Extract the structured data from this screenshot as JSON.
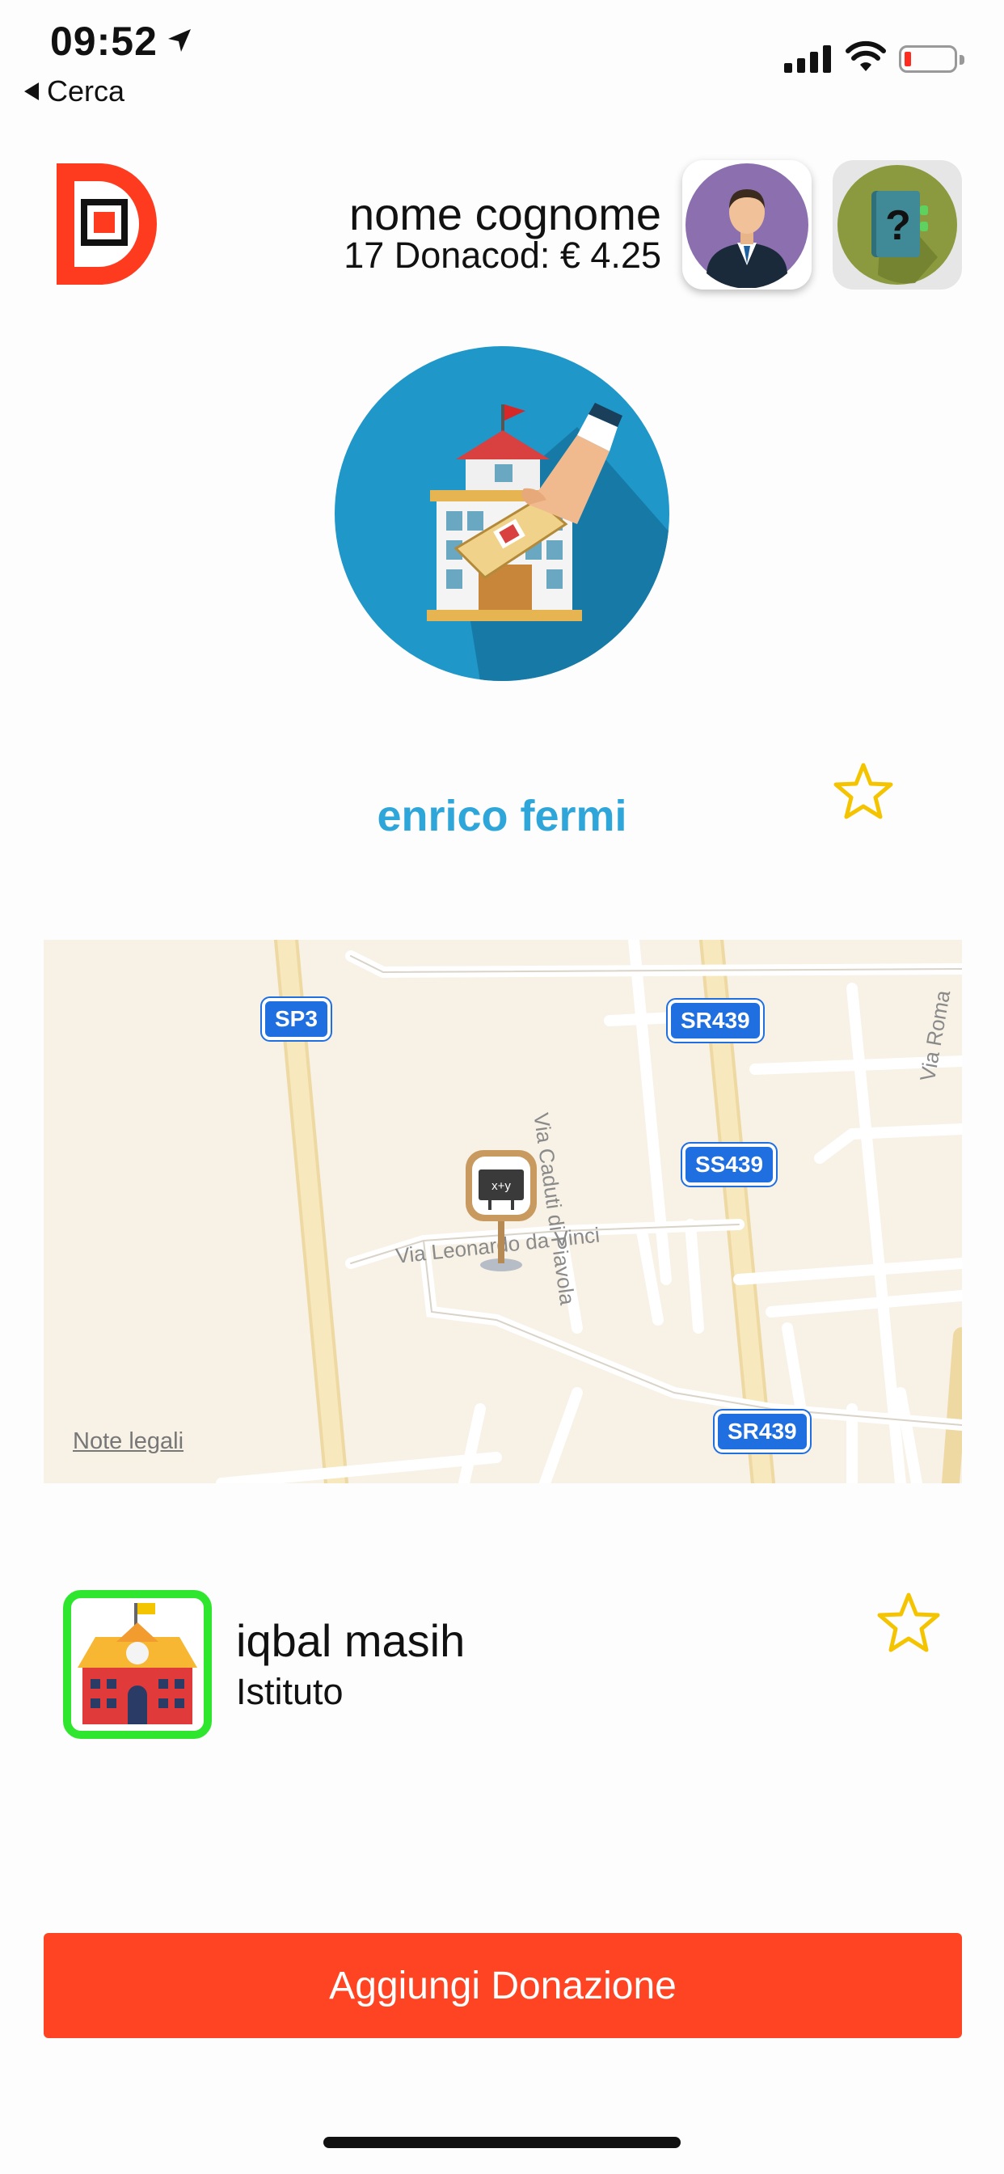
{
  "status_bar": {
    "time": "09:52",
    "back_label": "Cerca"
  },
  "header": {
    "user_name": "nome cognome",
    "user_balance": "17 Donacod: € 4.25",
    "avatar_icon": "person-avatar-icon",
    "help_icon": "help-book-icon"
  },
  "institution": {
    "name": "enrico fermi",
    "hero_icon": "school-donation-icon",
    "favorite_icon": "star-outline-icon"
  },
  "map": {
    "legal_link": "Note legali",
    "roads": {
      "sp3": "SP3",
      "sr439_top": "SR439",
      "ss439": "SS439",
      "sr439_bottom": "SR439",
      "via_caduti": "Via Caduti di Piavola",
      "via_roma": "Via Roma",
      "via_leonardo": "Via Leonardo da Vinci"
    }
  },
  "list": {
    "items": [
      {
        "name": "iqbal masih",
        "type": "Istituto",
        "icon": "school-building-icon"
      }
    ]
  },
  "actions": {
    "donate_label": "Aggiungi Donazione"
  },
  "colors": {
    "accent": "#ff4424",
    "title": "#2fa6d9",
    "selected_border": "#2ee62e",
    "star": "#f5c400"
  }
}
